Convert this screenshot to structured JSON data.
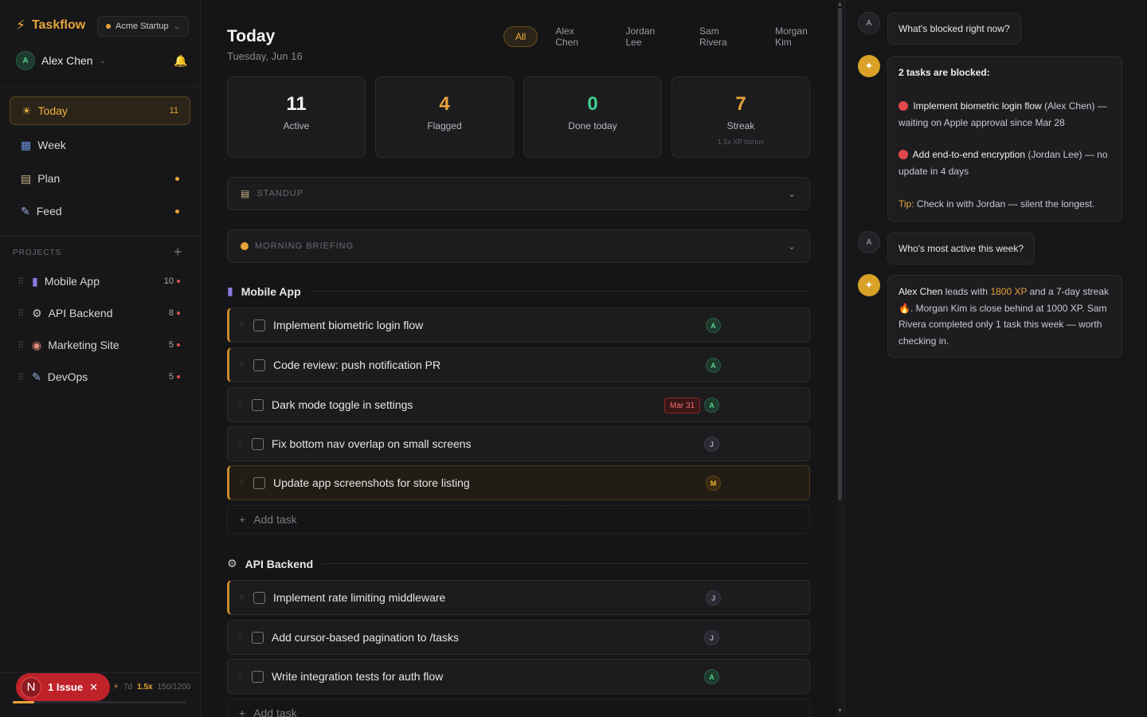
{
  "app": {
    "name": "Taskflow",
    "workspace": "Acme Startup"
  },
  "user": {
    "name": "Alex Chen",
    "initial": "A"
  },
  "nav": [
    {
      "label": "Today",
      "icon": "☀",
      "count": "11"
    },
    {
      "label": "Week",
      "icon": "▦"
    },
    {
      "label": "Plan",
      "icon": "▤"
    },
    {
      "label": "Feed",
      "icon": "✎"
    }
  ],
  "projects_header": "PROJECTS",
  "projects": [
    {
      "name": "Mobile App",
      "icon": "▮",
      "count": "10"
    },
    {
      "name": "API Backend",
      "icon": "⚙",
      "count": "8"
    },
    {
      "name": "Marketing Site",
      "icon": "◉",
      "count": "5"
    },
    {
      "name": "DevOps",
      "icon": "✎",
      "count": "5"
    }
  ],
  "footer": {
    "issue_letter": "N",
    "issue_label": "1 Issue",
    "streak_days": "7d",
    "multiplier": "1.5x",
    "xp": "150/1200",
    "xp_progress": 0.125
  },
  "main": {
    "title": "Today",
    "date": "Tuesday, Jun 16",
    "filters": [
      "All",
      "Alex Chen",
      "Jordan Lee",
      "Sam Rivera",
      "Morgan Kim"
    ],
    "stats": [
      {
        "value": "11",
        "label": "Active",
        "color": "#f2f2f2"
      },
      {
        "value": "4",
        "label": "Flagged",
        "color": "#e8a33a"
      },
      {
        "value": "0",
        "label": "Done today",
        "color": "#3fcf8e"
      },
      {
        "value": "7",
        "label": "Streak",
        "sub": "1.5x XP bonus",
        "color": "#e8a33a"
      }
    ],
    "standup_label": "STANDUP",
    "briefing_label": "MORNING BRIEFING",
    "sections": [
      {
        "name": "Mobile App",
        "tasks": [
          {
            "title": "Implement biometric login flow",
            "assignee": "A"
          },
          {
            "title": "Code review: push notification PR",
            "assignee": "A"
          },
          {
            "title": "Dark mode toggle in settings",
            "assignee": "A",
            "due": "Mar 31"
          },
          {
            "title": "Fix bottom nav overlap on small screens",
            "assignee": "J"
          },
          {
            "title": "Update app screenshots for store listing",
            "assignee": "M"
          }
        ],
        "add_label": "Add task"
      },
      {
        "name": "API Backend",
        "tasks": [
          {
            "title": "Implement rate limiting middleware",
            "assignee": "J"
          },
          {
            "title": "Add cursor-based pagination to /tasks",
            "assignee": "J"
          },
          {
            "title": "Write integration tests for auth flow",
            "assignee": "A"
          }
        ],
        "add_label": "Add task"
      }
    ]
  },
  "chat": {
    "q1": "What's blocked right now?",
    "a1": {
      "heading": "2 tasks are blocked:",
      "item1_task": "Implement biometric login flow",
      "item1_owner": "(Alex Chen)",
      "item1_note": "— waiting on Apple approval since Mar 28",
      "item2_task": "Add end-to-end encryption",
      "item2_owner": "(Jordan Lee) —",
      "item2_note": "no update in 4 days",
      "tip_label": "Tip:",
      "tip_text": "Check in with Jordan — silent the longest."
    },
    "q2": "Who's most active this week?",
    "a2": {
      "name": "Alex Chen",
      "t1": "leads with",
      "xp": "1800 XP",
      "t2": "and a 7-day streak",
      "fire": "🔥",
      "t3": ". Morgan Kim is close behind at 1000 XP. Sam Rivera completed only 1 task this week — worth checking in."
    },
    "bot_icon": "✦",
    "user_initial": "A"
  }
}
